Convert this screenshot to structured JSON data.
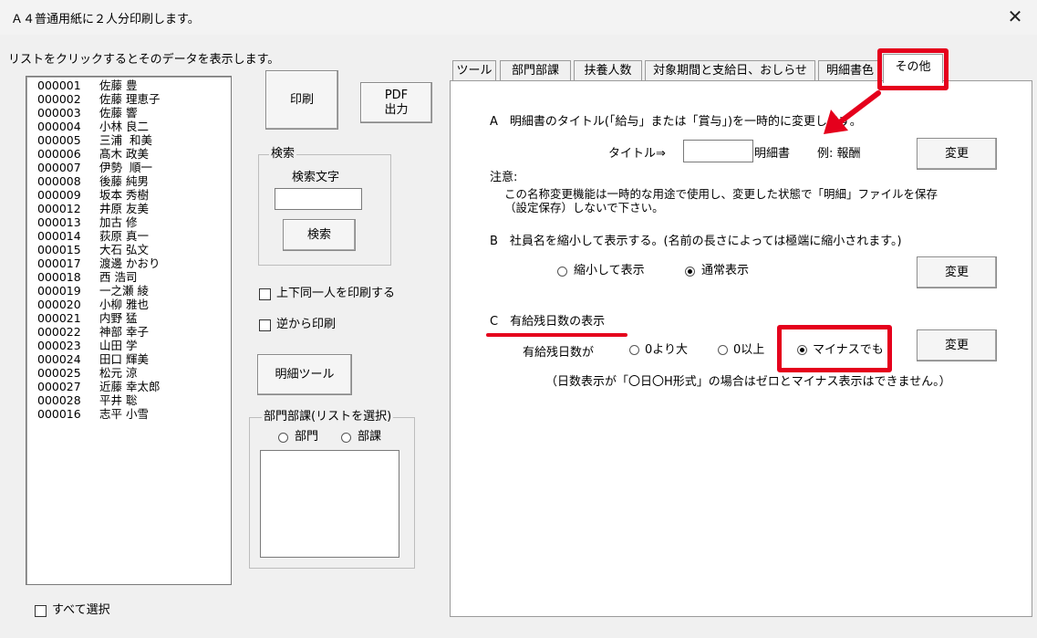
{
  "window": {
    "title": "Ａ４普通用紙に２人分印刷します。",
    "close_glyph": "✕"
  },
  "list": {
    "hint": "リストをクリックするとそのデータを表示します。",
    "items": [
      {
        "id": "000001",
        "name": "佐藤 豊"
      },
      {
        "id": "000002",
        "name": "佐藤 理恵子"
      },
      {
        "id": "000003",
        "name": "佐藤 響"
      },
      {
        "id": "000004",
        "name": "小林 良二"
      },
      {
        "id": "000005",
        "name": "三浦  和美"
      },
      {
        "id": "000006",
        "name": "髙木 政美"
      },
      {
        "id": "000007",
        "name": "伊勢  順一"
      },
      {
        "id": "000008",
        "name": "後藤 純男"
      },
      {
        "id": "000009",
        "name": "坂本 秀樹"
      },
      {
        "id": "000012",
        "name": "井原 友美"
      },
      {
        "id": "000013",
        "name": "加古 修"
      },
      {
        "id": "000014",
        "name": "荻原 真一"
      },
      {
        "id": "000015",
        "name": "大石 弘文"
      },
      {
        "id": "000017",
        "name": "渡邊 かおり"
      },
      {
        "id": "000018",
        "name": "西 浩司"
      },
      {
        "id": "000019",
        "name": "一之瀬 綾"
      },
      {
        "id": "000020",
        "name": "小柳 雅也"
      },
      {
        "id": "000021",
        "name": "内野 猛"
      },
      {
        "id": "000022",
        "name": "神部 幸子"
      },
      {
        "id": "000023",
        "name": "山田 学"
      },
      {
        "id": "000024",
        "name": "田口 輝美"
      },
      {
        "id": "000025",
        "name": "松元 涼"
      },
      {
        "id": "000027",
        "name": "近藤 幸太郎"
      },
      {
        "id": "000028",
        "name": "平井 聡"
      },
      {
        "id": "000016",
        "name": "志平 小雪"
      }
    ],
    "select_all": "すべて選択"
  },
  "buttons": {
    "print": "印刷",
    "pdf": "PDF\n出力",
    "search": "検索",
    "detail_tool": "明細ツール"
  },
  "search": {
    "group_title": "検索",
    "label": "検索文字",
    "value": ""
  },
  "options": {
    "same_person": "上下同一人を印刷する",
    "reverse": "逆から印刷"
  },
  "dept": {
    "group_title": "部門部課(リストを選択)",
    "radio_dept": "部門",
    "radio_section": "部課"
  },
  "tabs": [
    {
      "label": "ツール",
      "active": false
    },
    {
      "label": "部門部課",
      "active": false
    },
    {
      "label": "扶養人数",
      "active": false
    },
    {
      "label": "対象期間と支給日、おしらせ",
      "active": false
    },
    {
      "label": "明細書色",
      "active": false
    },
    {
      "label": "その他",
      "active": true
    }
  ],
  "sectionA": {
    "heading": "A　明細書のタイトル(「給与」または「賞与」)を一時的に変更します。",
    "title_label": "タイトル⇒",
    "title_value": "",
    "suffix": "明細書",
    "example": "例:  報酬",
    "change": "変更",
    "note_title": "注意:",
    "note_line1": "この名称変更機能は一時的な用途で使用し、変更した状態で「明細」ファイルを保存",
    "note_line2": "（設定保存）しないで下さい。"
  },
  "sectionB": {
    "heading": "B　社員名を縮小して表示する。(名前の長さによっては極端に縮小されます。)",
    "opt_shrink": "縮小して表示",
    "opt_normal": "通常表示",
    "selected": "normal",
    "change": "変更"
  },
  "sectionC": {
    "heading": "C　有給残日数の表示",
    "label": "有給残日数が",
    "opt_gt0": "0より大",
    "opt_ge0": "0以上",
    "opt_negative": "マイナスでも",
    "selected": "negative",
    "change": "変更",
    "note": "（日数表示が「〇日〇H形式」の場合はゼロとマイナス表示はできません。）"
  },
  "annotation_color": "#e5001c"
}
